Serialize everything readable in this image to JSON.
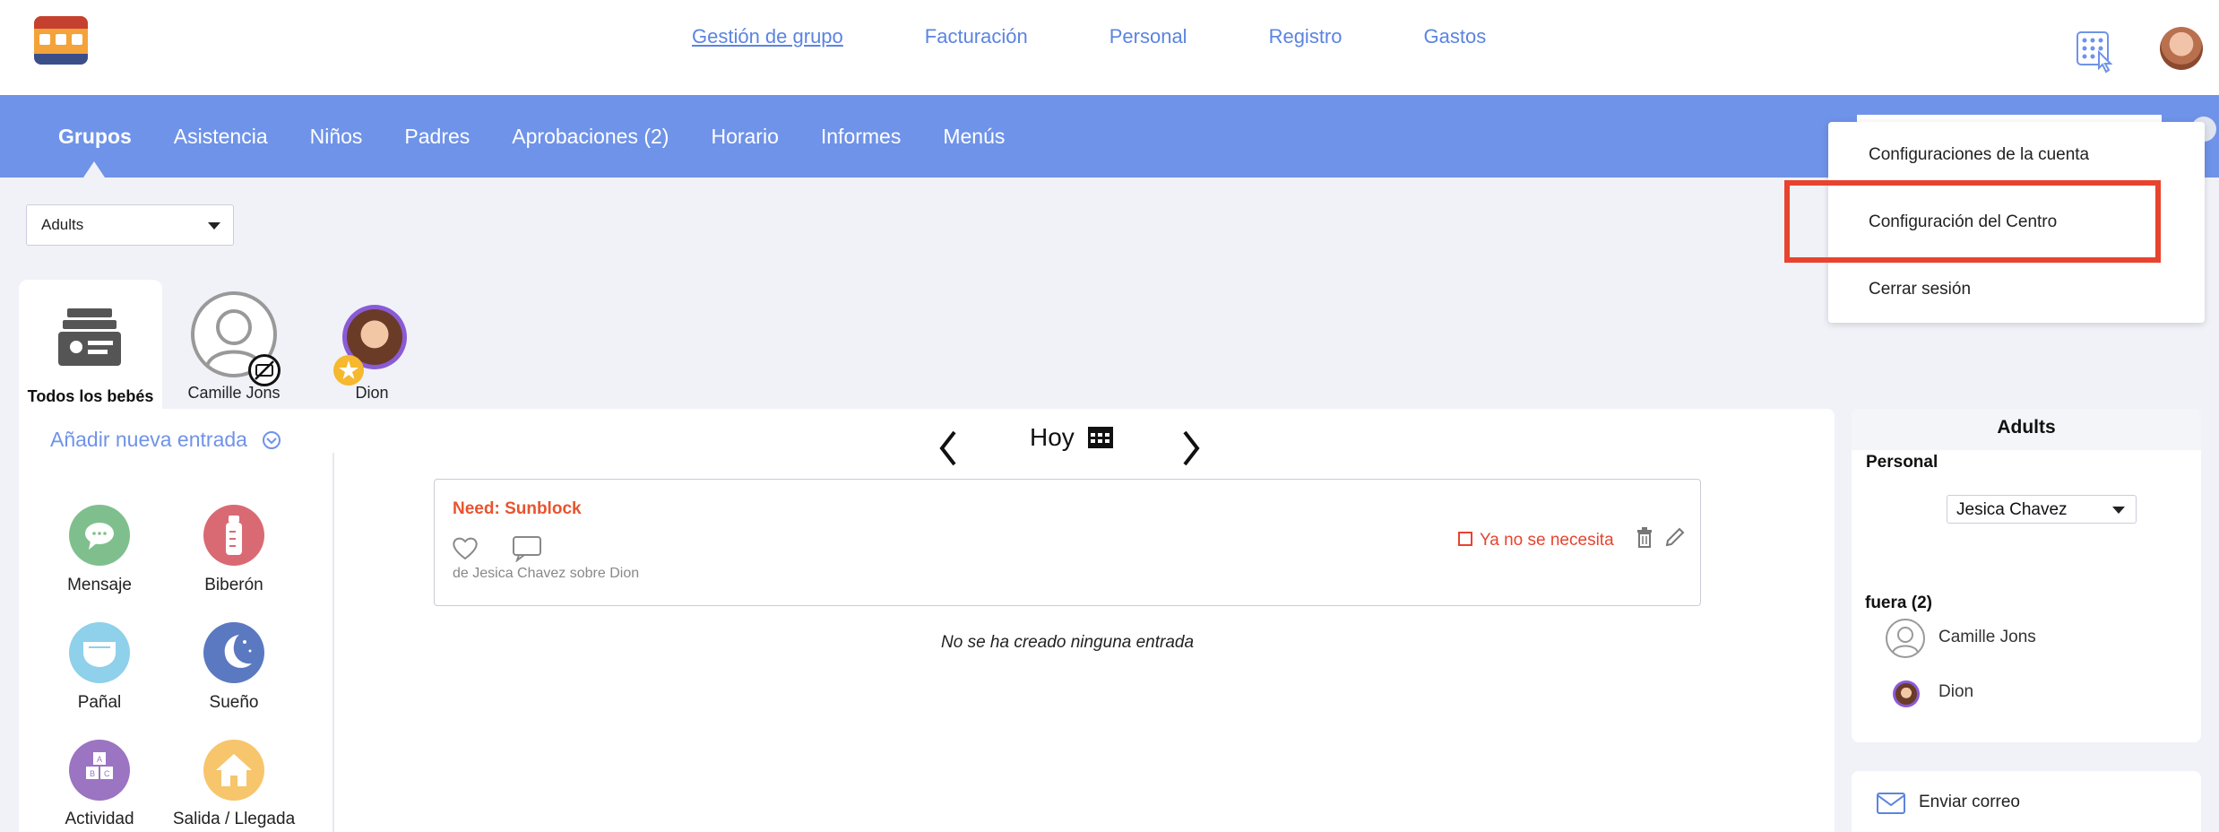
{
  "topnav": {
    "links": [
      {
        "label": "Gestión de grupo",
        "active": true
      },
      {
        "label": "Facturación",
        "active": false
      },
      {
        "label": "Personal",
        "active": false
      },
      {
        "label": "Registro",
        "active": false
      },
      {
        "label": "Gastos",
        "active": false
      }
    ],
    "keypad_icon": "keypad-icon",
    "avatar_icon": "user-avatar"
  },
  "tabs": [
    {
      "label": "Grupos",
      "active": true
    },
    {
      "label": "Asistencia",
      "active": false
    },
    {
      "label": "Niños",
      "active": false
    },
    {
      "label": "Padres",
      "active": false
    },
    {
      "label": "Aprobaciones (2)",
      "active": false
    },
    {
      "label": "Horario",
      "active": false
    },
    {
      "label": "Informes",
      "active": false
    },
    {
      "label": "Menús",
      "active": false
    }
  ],
  "menu": {
    "items": [
      "Configuraciones de la cuenta",
      "Configuración del Centro",
      "Cerrar sesión"
    ],
    "highlighted_color": "#e8432e"
  },
  "group_select": {
    "value": "Adults"
  },
  "children": {
    "all_label": "Todos los bebés",
    "list": [
      {
        "name": "Camille Jons"
      },
      {
        "name": "Dion"
      }
    ]
  },
  "entry_panel": {
    "add_label": "Añadir nueva entrada",
    "activities": [
      "Mensaje",
      "Biberón",
      "Pañal",
      "Sueño",
      "Actividad",
      "Salida / Llegada"
    ],
    "date_label": "Hoy",
    "entry": {
      "title": "Need: Sunblock",
      "meta": "de Jesica Chavez sobre Dion",
      "not_needed_label": "Ya no se necesita"
    },
    "empty_text": "No se ha creado ninguna entrada"
  },
  "sidebar": {
    "title": "Adults",
    "staff_label": "Personal",
    "staff_value": "Jesica Chavez",
    "out_label": "fuera (2)",
    "out_list": [
      "Camille Jons",
      "Dion"
    ],
    "email_label": "Enviar correo"
  },
  "colors": {
    "accent": "#6f93e8",
    "alert": "#e8432e",
    "entry_title": "#e8542e"
  }
}
